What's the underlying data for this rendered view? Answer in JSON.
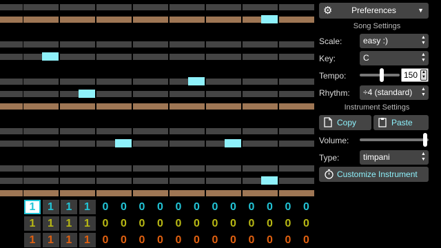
{
  "colors": {
    "accent": "#8ef1fb",
    "row_gray": "#444444",
    "row_brown": "#9e7654",
    "channel_1": "#22c4d6",
    "channel_2": "#b8b814",
    "channel_3": "#e06010"
  },
  "editor": {
    "rows": [
      {
        "kind": "gray",
        "note_col": null
      },
      {
        "kind": "brown",
        "note_col": 7
      },
      {
        "kind": "blank",
        "note_col": null
      },
      {
        "kind": "gray",
        "note_col": null
      },
      {
        "kind": "gray",
        "note_col": 1
      },
      {
        "kind": "blank",
        "note_col": null
      },
      {
        "kind": "gray",
        "note_col": 5
      },
      {
        "kind": "gray",
        "note_col": 2
      },
      {
        "kind": "brown",
        "note_col": null
      },
      {
        "kind": "blank",
        "note_col": null
      },
      {
        "kind": "gray",
        "note_col": null
      },
      {
        "kind": "gray",
        "note_col": 3,
        "note_col_2": 6
      },
      {
        "kind": "blank",
        "note_col": null
      },
      {
        "kind": "gray",
        "note_col": null
      },
      {
        "kind": "gray",
        "note_col": 7
      },
      {
        "kind": "brown",
        "note_col": null
      }
    ]
  },
  "channels": [
    {
      "color_key": "channel_1",
      "values": [
        "1",
        "1",
        "1",
        "1",
        "0",
        "0",
        "0",
        "0",
        "0",
        "0",
        "0",
        "0",
        "0",
        "0",
        "0",
        "0"
      ]
    },
    {
      "color_key": "channel_2",
      "values": [
        "1",
        "1",
        "1",
        "1",
        "0",
        "0",
        "0",
        "0",
        "0",
        "0",
        "0",
        "0",
        "0",
        "0",
        "0",
        "0"
      ]
    },
    {
      "color_key": "channel_3",
      "values": [
        "1",
        "1",
        "1",
        "1",
        "0",
        "0",
        "0",
        "0",
        "0",
        "0",
        "0",
        "0",
        "0",
        "0",
        "0",
        "0"
      ]
    }
  ],
  "panel": {
    "preferences_label": "Preferences",
    "song_settings_heading": "Song Settings",
    "scale_label": "Scale:",
    "scale_value": "easy :)",
    "key_label": "Key:",
    "key_value": "C",
    "tempo_label": "Tempo:",
    "tempo_value": "150",
    "tempo_level": 0.55,
    "rhythm_label": "Rhythm:",
    "rhythm_value": "÷4 (standard)",
    "instrument_settings_heading": "Instrument Settings",
    "copy_label": "Copy",
    "paste_label": "Paste",
    "volume_label": "Volume:",
    "volume_level": 0.95,
    "type_label": "Type:",
    "type_value": "timpani",
    "customize_label": "Customize Instrument"
  },
  "icons": [
    "gear-icon",
    "chevron-down-icon",
    "copy-icon",
    "paste-icon",
    "stopwatch-icon",
    "up-down-arrows-icon"
  ]
}
